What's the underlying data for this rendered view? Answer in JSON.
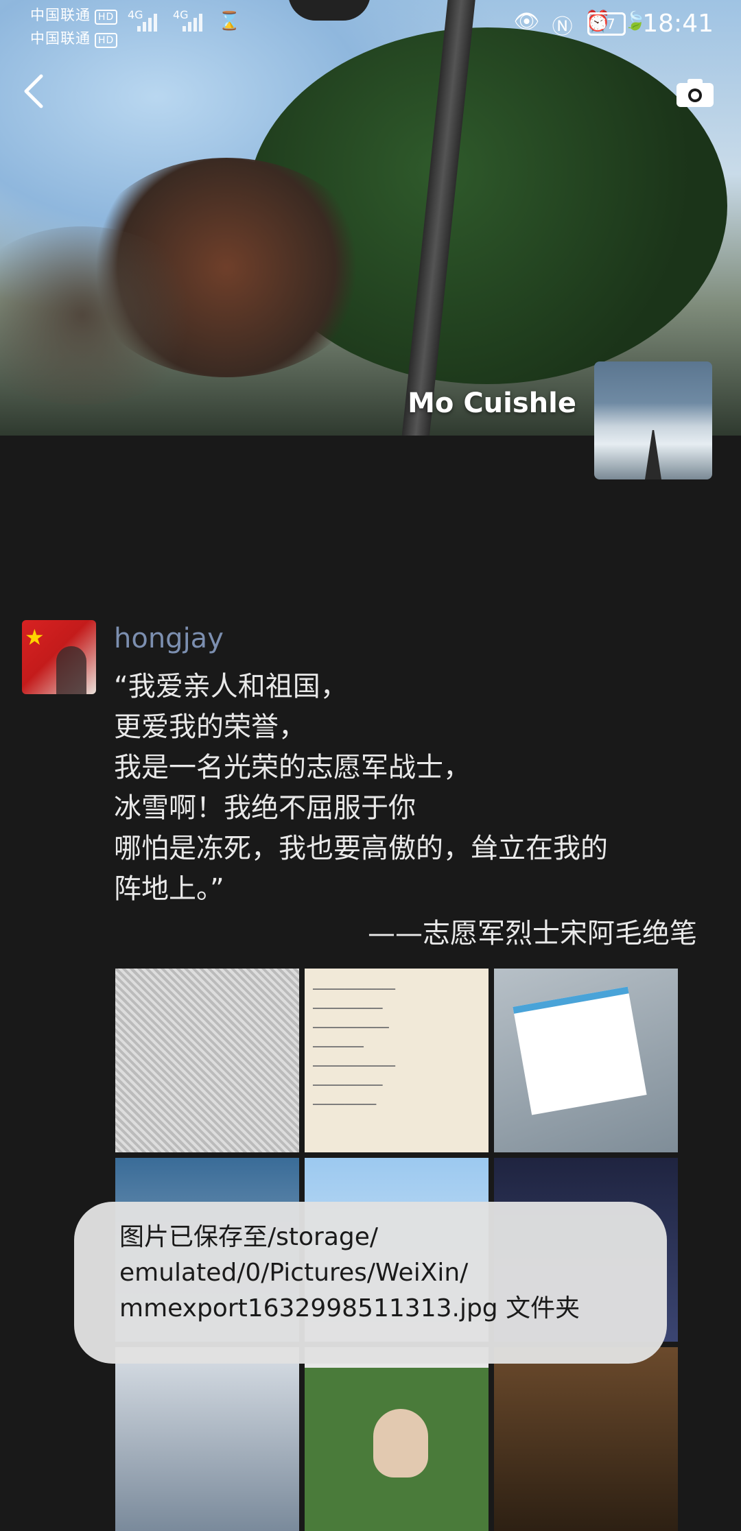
{
  "status_bar": {
    "carrier1": "中国联通",
    "carrier2": "中国联通",
    "hd_badge": "HD",
    "signal1": "4G",
    "signal2": "4G",
    "battery": "67",
    "time": "18:41",
    "icons": [
      "eye-icon",
      "nfc-icon",
      "alarm-icon",
      "leaf-icon"
    ]
  },
  "header": {
    "back_icon": "chevron-left-icon",
    "camera_icon": "camera-icon"
  },
  "profile": {
    "name": "Mo Cuishle"
  },
  "post": {
    "author": "hongjay",
    "lines": [
      "“我爱亲人和祖国，",
      "更爱我的荣誉，",
      "我是一名光荣的志愿军战士，",
      "冰雪啊！我绝不屈服于你",
      "哪怕是冻死，我也要高傲的，耸立在我的",
      "阵地上。”"
    ],
    "signature": "——志愿军烈士宋阿毛绝笔",
    "photos_count": 9
  },
  "toast": {
    "line1": "图片已保存至/storage/",
    "line2": "emulated/0/Pictures/WeiXin/",
    "line3": "mmexport1632998511313.jpg 文件夹"
  }
}
